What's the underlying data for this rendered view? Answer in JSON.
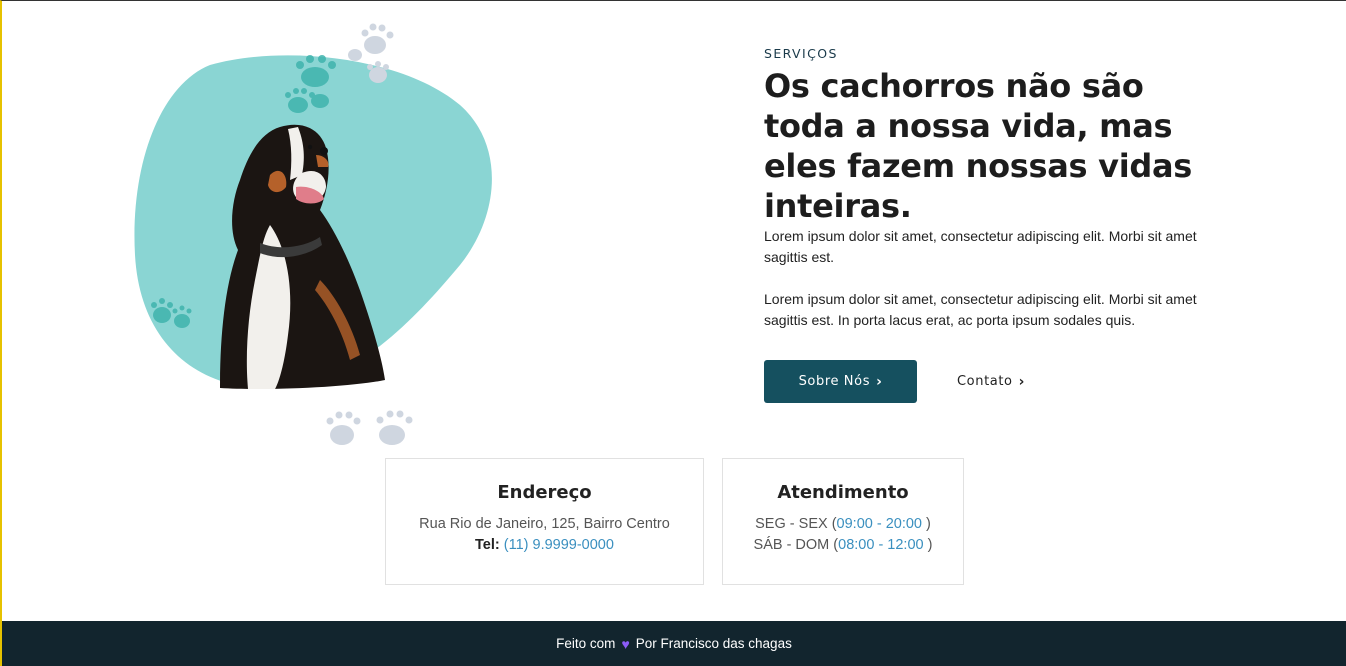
{
  "services": {
    "eyebrow": "SERVIÇOS",
    "title": "Os cachorros não são toda a nossa vida, mas eles fazem nossas vidas inteiras.",
    "paragraph_1": "Lorem ipsum dolor sit amet, consectetur adipiscing elit. Morbi sit amet sagittis est.",
    "paragraph_2": "Lorem ipsum dolor sit amet, consectetur adipiscing elit. Morbi sit amet sagittis est. In porta lacus erat, ac porta ipsum sodales quis.",
    "primary_button": "Sobre Nós",
    "secondary_button": "Contato",
    "chevron_icon": "chevron-right-icon"
  },
  "address_card": {
    "title": "Endereço",
    "street": "Rua Rio de Janeiro, 125, Bairro Centro",
    "phone_label": "Tel:",
    "phone": "(11) 9.9999-0000"
  },
  "hours_card": {
    "title": "Atendimento",
    "row1_days": "SEG - SEX (",
    "row1_hours": "09:00 - 20:00",
    "row1_close": " )",
    "row2_days": "SÁB - DOM (",
    "row2_hours": "08:00 - 12:00",
    "row2_close": " )"
  },
  "footer": {
    "prefix": "Feito com",
    "icon": "heart-icon",
    "suffix": "Por Francisco das chagas"
  },
  "colors": {
    "blob": "#8ad5d3",
    "paw_teal": "#3fb3ad",
    "paw_grey": "#cfd6e0",
    "primary": "#15505f",
    "accent_link": "#3a8fbf",
    "footer_bg": "#12252e",
    "heart": "#8b5cf6"
  }
}
